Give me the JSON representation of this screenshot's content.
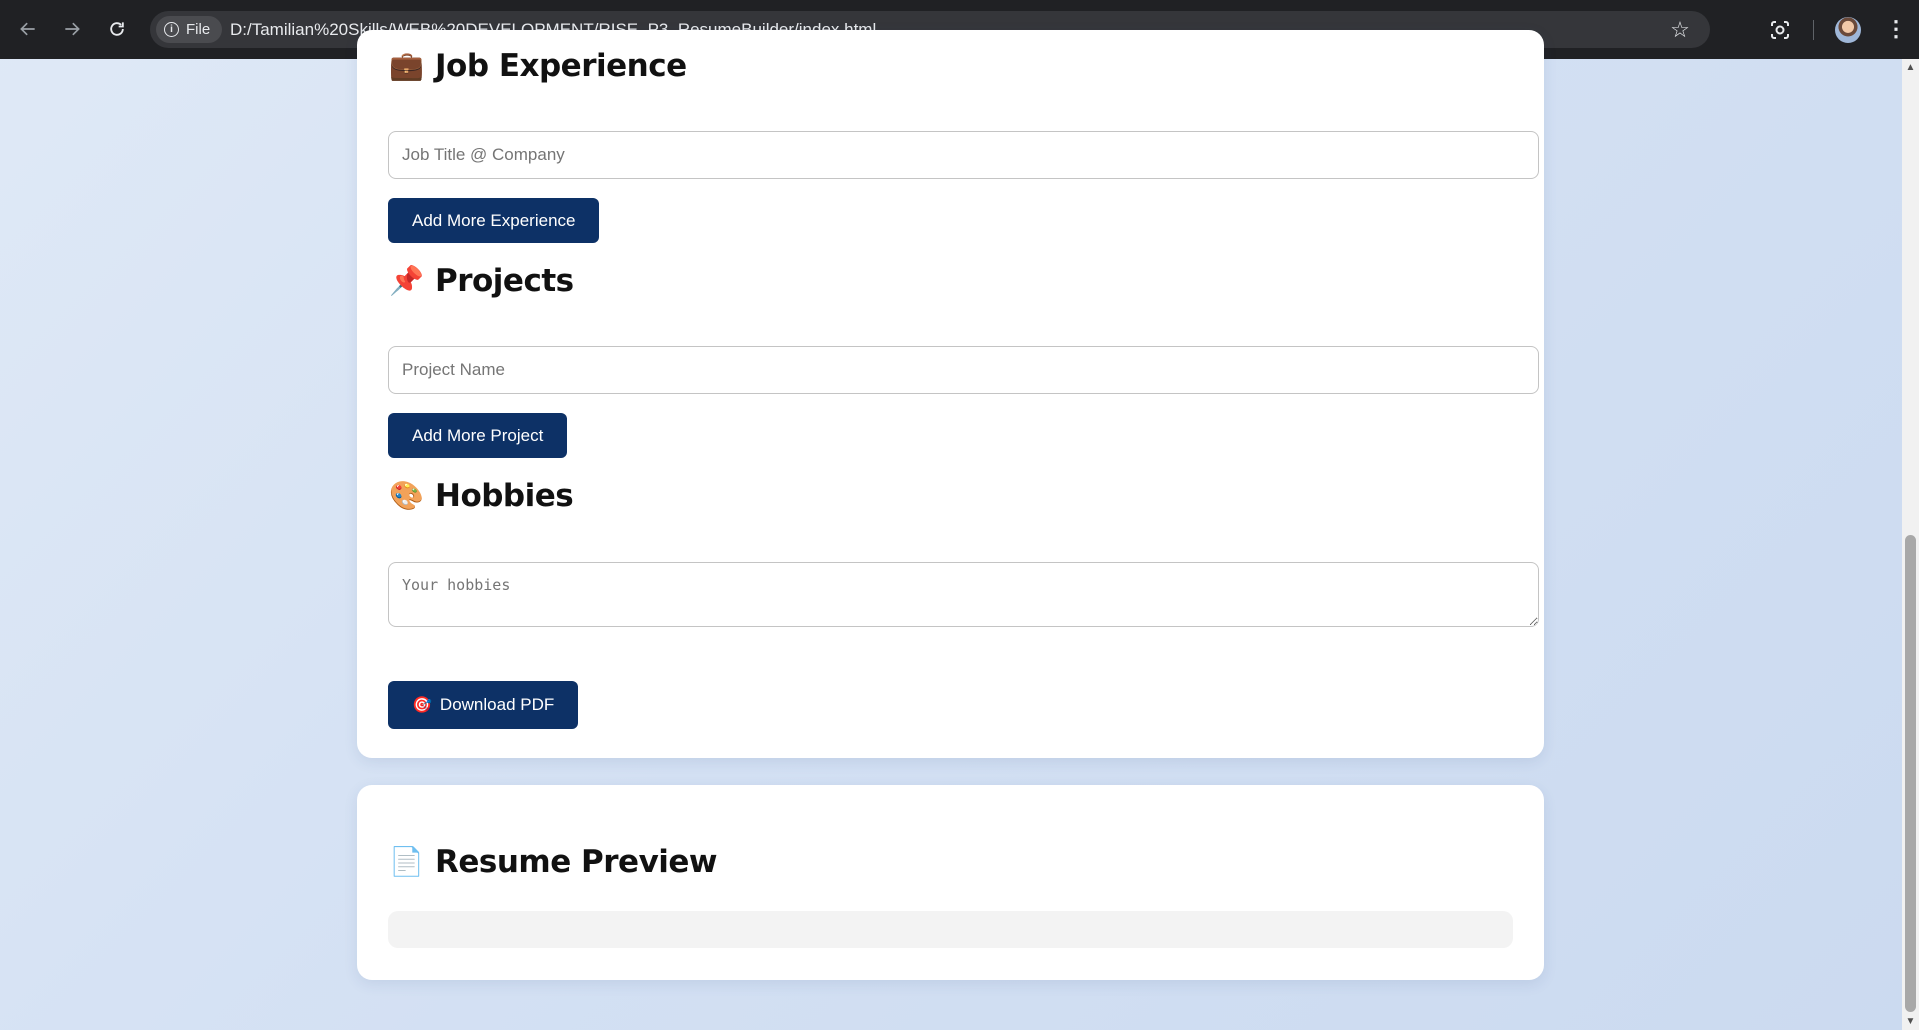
{
  "browser": {
    "file_chip": "File",
    "url": "D:/Tamilian%20Skills/WEB%20DEVELOPMENT/RISE_P3_ResumeBuilder/index.html"
  },
  "sections": {
    "experience": {
      "icon": "💼",
      "title": "Job Experience",
      "input_placeholder": "Job Title @ Company",
      "input_value": "",
      "button_label": "Add More Experience"
    },
    "projects": {
      "icon": "📌",
      "title": "Projects",
      "input_placeholder": "Project Name",
      "input_value": "",
      "button_label": "Add More Project"
    },
    "hobbies": {
      "icon": "🎨",
      "title": "Hobbies",
      "input_placeholder": "Your hobbies",
      "input_value": ""
    },
    "download": {
      "icon": "🎯",
      "button_label": "Download PDF"
    }
  },
  "preview": {
    "icon": "📄",
    "title": "Resume Preview"
  },
  "icons": {
    "back": "arrow-left-icon",
    "forward": "arrow-right-icon",
    "reload": "reload-icon",
    "info": "info-icon",
    "bookmark": "star-icon",
    "lens": "google-lens-icon",
    "menu": "kebab-menu-icon"
  },
  "colors": {
    "primary_button": "#0d3166",
    "page_background": "#d3e0f3",
    "card_background": "#ffffff",
    "browser_chrome": "#202124"
  }
}
